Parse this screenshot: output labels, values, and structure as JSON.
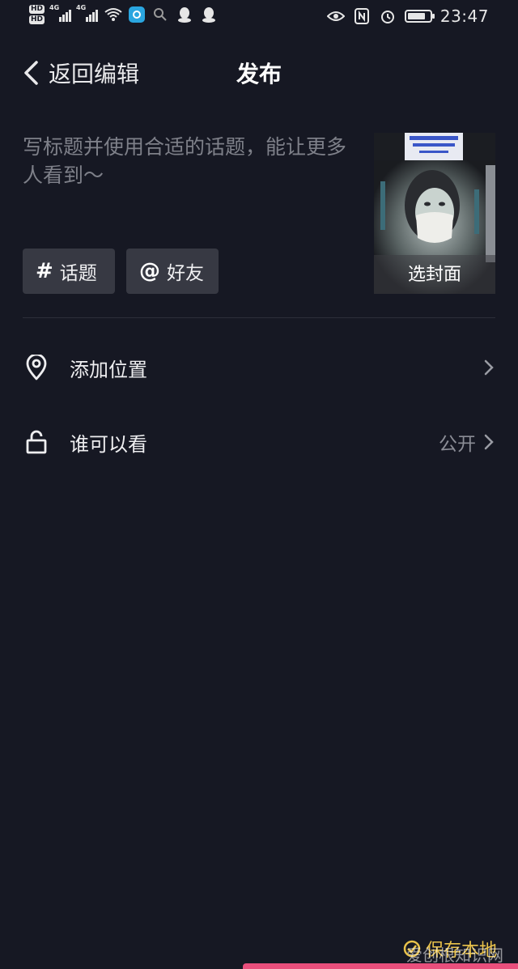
{
  "status_bar": {
    "hd1": "HD",
    "hd2": "HD",
    "net1": "4G",
    "net2": "4G",
    "time": "23:47",
    "battery_level": 0.8
  },
  "header": {
    "back_label": "返回编辑",
    "title": "发布"
  },
  "caption": {
    "placeholder": "写标题并使用合适的话题，能让更多人看到～"
  },
  "cover": {
    "label": "选封面"
  },
  "chips": [
    {
      "symbol": "#",
      "label": "话题"
    },
    {
      "symbol": "@",
      "label": "好友"
    }
  ],
  "rows": [
    {
      "label": "添加位置",
      "value": ""
    },
    {
      "label": "谁可以看",
      "value": "公开"
    }
  ],
  "bottom": {
    "save_local": "保存本地",
    "watermark": "爱创根知识网"
  },
  "colors": {
    "background": "#161823",
    "chip": "#373943",
    "accent_publish": "#e94f7c",
    "save_local": "#e9c24a"
  }
}
